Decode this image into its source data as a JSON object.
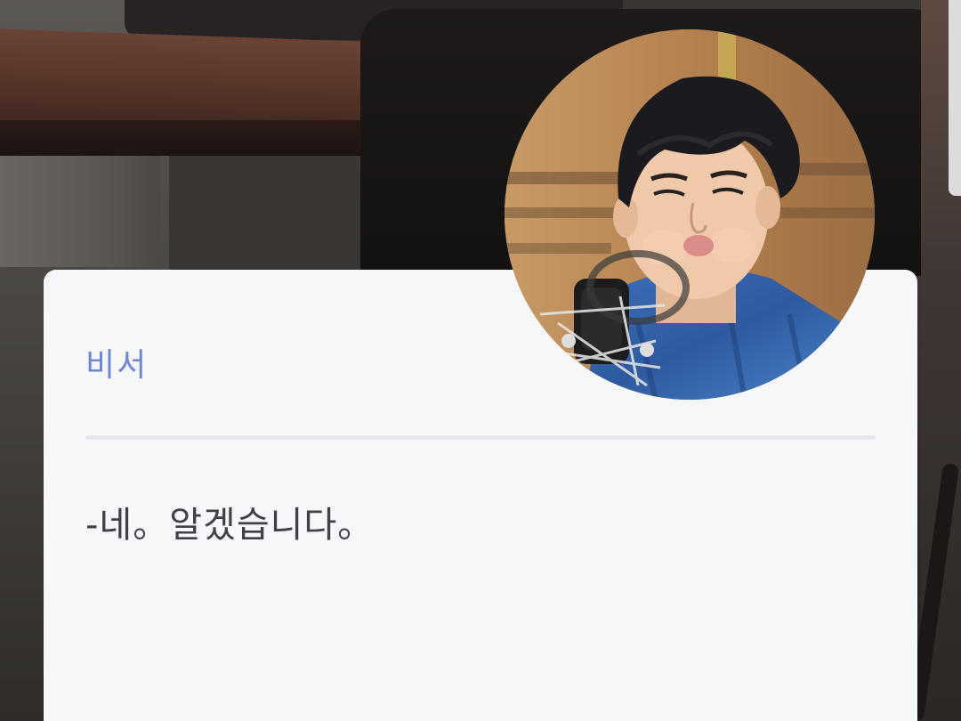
{
  "dialog": {
    "speaker": "비서",
    "message": "-네。알겠습니다。"
  },
  "avatar": {
    "icon": "character-portrait-icon"
  },
  "colors": {
    "speaker_name": "#6f86d6",
    "card_background": "#f5f7f9",
    "message_text": "#3e4247",
    "divider": "#e4e7eb"
  }
}
